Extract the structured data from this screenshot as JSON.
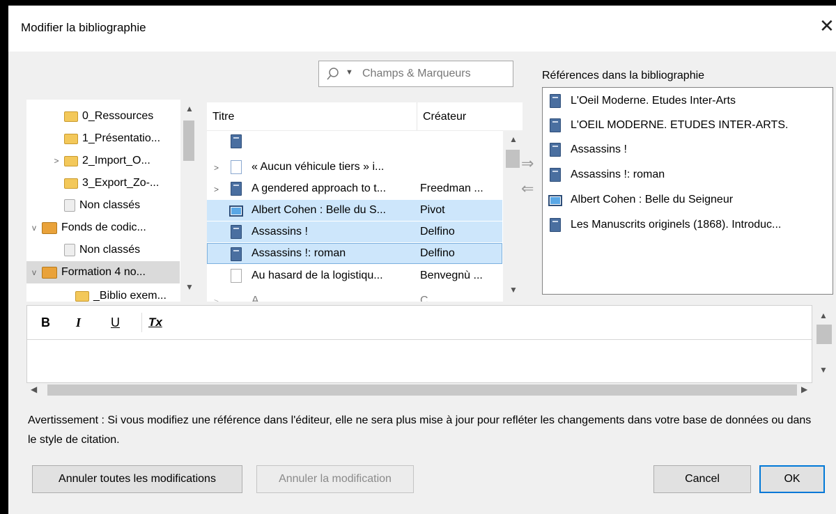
{
  "dialog": {
    "title": "Modifier la bibliographie",
    "close_glyph": "✕"
  },
  "search": {
    "placeholder": "Champs & Marqueurs",
    "mode_glyph": "▼"
  },
  "collections_tree": {
    "items": [
      {
        "label": "0_Ressources",
        "icon": "folder-icon",
        "twisty": ""
      },
      {
        "label": "1_Présentatio...",
        "icon": "folder-icon",
        "twisty": ""
      },
      {
        "label": "2_Import_O...",
        "icon": "folder-icon",
        "twisty": ">"
      },
      {
        "label": "3_Export_Zo-...",
        "icon": "folder-icon",
        "twisty": ""
      },
      {
        "label": "Non classés",
        "icon": "unfiled-icon",
        "twisty": ""
      },
      {
        "label": "Fonds de codic...",
        "icon": "library-icon",
        "twisty": "v"
      },
      {
        "label": "Non classés",
        "icon": "unfiled-icon",
        "twisty": ""
      },
      {
        "label": "Formation 4 no...",
        "icon": "library-icon",
        "twisty": "v",
        "selected": true
      },
      {
        "label": "_Biblio exem...",
        "icon": "folder-icon",
        "twisty": ""
      }
    ]
  },
  "items_list": {
    "columns": {
      "title": "Titre",
      "creator": "Créateur"
    },
    "rows": [
      {
        "title": "",
        "creator": "",
        "icon": "book-icon",
        "twisty": ""
      },
      {
        "title": "« Aucun véhicule tiers » i...",
        "creator": "",
        "icon": "document-icon",
        "twisty": ">"
      },
      {
        "title": "A gendered approach to t...",
        "creator": "Freedman ...",
        "icon": "book-icon",
        "twisty": ">"
      },
      {
        "title": "Albert Cohen : Belle du S...",
        "creator": "Pivot",
        "icon": "tv-broadcast-icon",
        "twisty": "",
        "selected": true
      },
      {
        "title": "Assassins !",
        "creator": "Delfino",
        "icon": "book-icon",
        "twisty": "",
        "selected": true
      },
      {
        "title": "Assassins !: roman",
        "creator": "Delfino",
        "icon": "book-icon",
        "twisty": "",
        "selected": true,
        "focused": true
      },
      {
        "title": "Au hasard de la logistiqu...",
        "creator": "Benvegnù ...",
        "icon": "document-icon",
        "twisty": ""
      },
      {
        "title": "A            ...",
        "creator": "C  ...",
        "icon": "document-icon",
        "twisty": ">"
      }
    ]
  },
  "transfer": {
    "add_glyph": "⇒",
    "remove_glyph": "⇐"
  },
  "references": {
    "label": "Références dans la bibliographie",
    "items": [
      {
        "title": "L'Oeil Moderne. Etudes Inter-Arts",
        "icon": "book-icon"
      },
      {
        "title": "L'OEIL MODERNE. ETUDES INTER-ARTS.",
        "icon": "book-icon"
      },
      {
        "title": "Assassins !",
        "icon": "book-icon"
      },
      {
        "title": "Assassins !: roman",
        "icon": "book-icon"
      },
      {
        "title": "Albert Cohen : Belle du Seigneur",
        "icon": "tv-broadcast-icon"
      },
      {
        "title": "Les Manuscrits originels (1868). Introduc...",
        "icon": "book-icon"
      }
    ]
  },
  "editor": {
    "bold": "B",
    "italic": "I",
    "underline": "U",
    "clear_format": "Tx",
    "content": ""
  },
  "warning": "Avertissement : Si vous modifiez une référence dans l'éditeur, elle ne sera plus mise à jour pour refléter les changements dans votre base de données ou dans le style de citation.",
  "buttons": {
    "revert_all": "Annuler toutes les modifications",
    "revert": "Annuler la modification",
    "cancel": "Cancel",
    "ok": "OK"
  },
  "colors": {
    "selection": "#cde6fb",
    "default_button_border": "#0078d7",
    "folder": "#f3c85a"
  }
}
